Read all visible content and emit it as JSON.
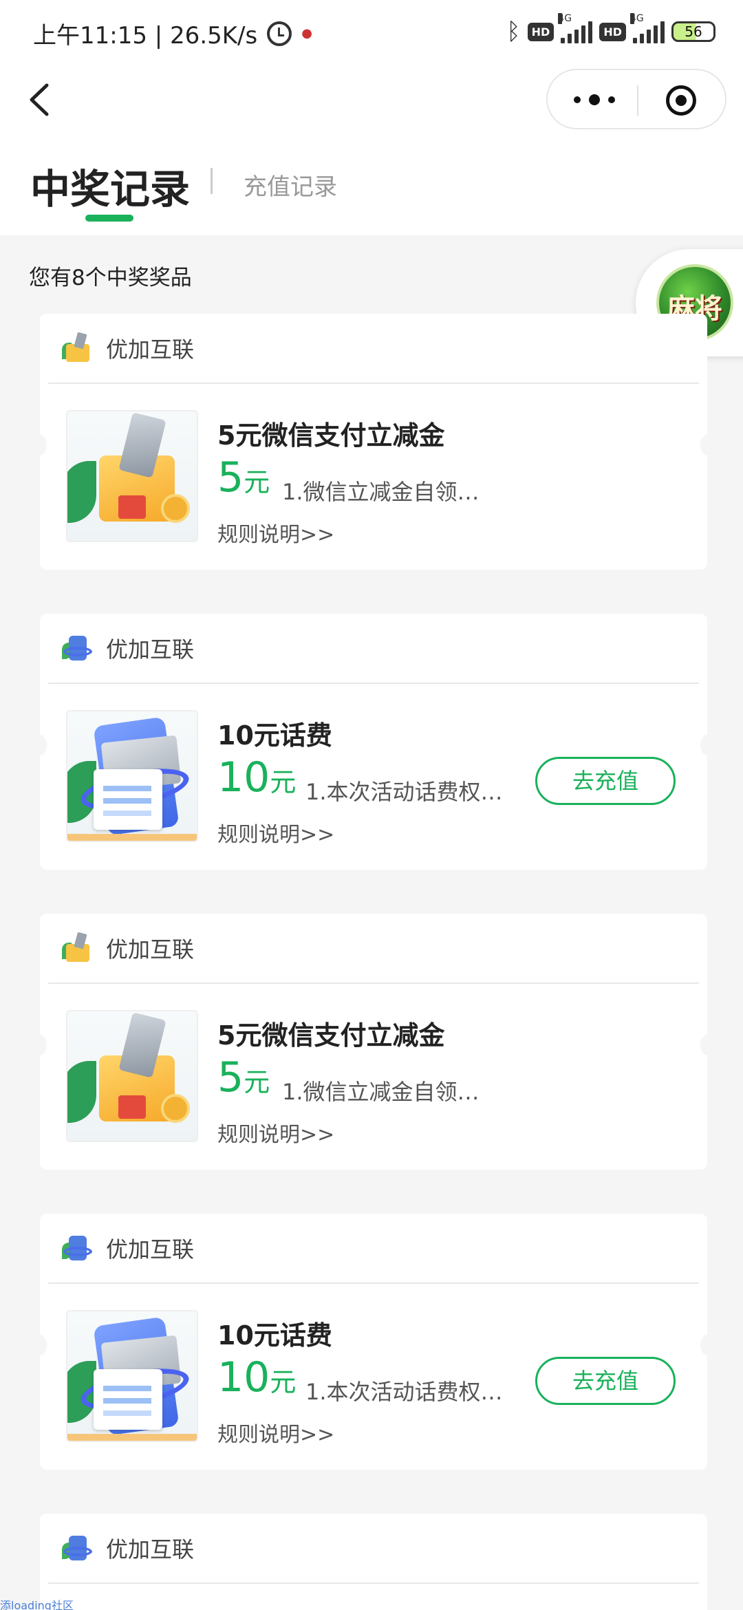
{
  "status_bar": {
    "time_speed": "上午11:15 | 26.5K/s",
    "network_label_1": "4G",
    "network_label_2": "4G",
    "hd_1": "HD",
    "hd_2": "HD",
    "battery": "56"
  },
  "nav": {
    "back_icon": "chevron-left-icon",
    "more_icon": "more-dots-icon",
    "close_icon": "target-icon"
  },
  "tabs": {
    "active": "中奖记录",
    "inactive": "充值记录"
  },
  "summary": "您有8个中奖奖品",
  "float_badge_text": "麻将",
  "accent_color": "#19b15a",
  "cards": [
    {
      "brand": "优加互联",
      "title": "5元微信支付立减金",
      "value": "5",
      "unit": "元",
      "desc": "1.微信立减金自领…",
      "rule": "规则说明>>"
    },
    {
      "brand": "优加互联",
      "title": "10元话费",
      "value": "10",
      "unit": "元",
      "desc": "1.本次活动话费权…",
      "rule": "规则说明>>",
      "button": "去充值"
    },
    {
      "brand": "优加互联",
      "title": "5元微信支付立减金",
      "value": "5",
      "unit": "元",
      "desc": "1.微信立减金自领…",
      "rule": "规则说明>>"
    },
    {
      "brand": "优加互联",
      "title": "10元话费",
      "value": "10",
      "unit": "元",
      "desc": "1.本次活动话费权…",
      "rule": "规则说明>>",
      "button": "去充值"
    },
    {
      "brand": "优加互联"
    }
  ],
  "watermark": "添loading社区"
}
